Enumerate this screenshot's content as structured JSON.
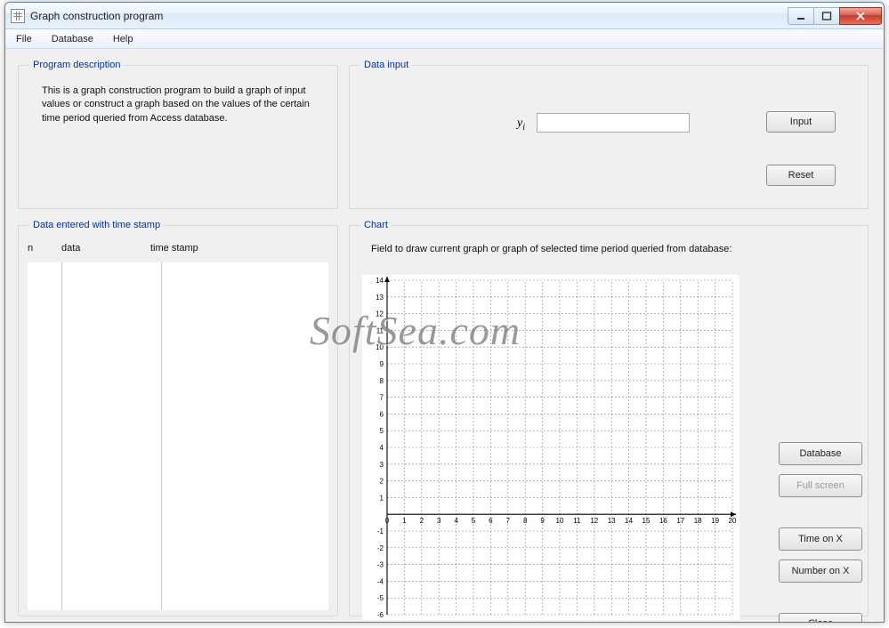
{
  "window": {
    "title": "Graph construction program"
  },
  "menu": {
    "file": "File",
    "database": "Database",
    "help": "Help"
  },
  "desc": {
    "legend": "Program description",
    "text": "This is a graph construction program to build a graph of input values or construct a graph based on the values of the certain time period queried from Access database."
  },
  "input": {
    "legend": "Data input",
    "y_label": "y",
    "y_sub": "i",
    "value": "",
    "input_btn": "Input",
    "reset_btn": "Reset"
  },
  "datatable": {
    "legend": "Data entered with time stamp",
    "col_n": "n",
    "col_data": "data",
    "col_ts": "time stamp"
  },
  "chart": {
    "legend": "Chart",
    "caption": "Field to draw current graph or graph of selected time period queried from database:"
  },
  "sidebar": {
    "database": "Database",
    "fullscreen": "Full screen",
    "time_x": "Time on X",
    "number_x": "Number on X",
    "close": "Close"
  },
  "watermark": "SoftSea.com",
  "chart_data": {
    "type": "line",
    "title": "",
    "xlabel": "",
    "ylabel": "",
    "x_ticks": [
      0,
      1,
      2,
      3,
      4,
      5,
      6,
      7,
      8,
      9,
      10,
      11,
      12,
      13,
      14,
      15,
      16,
      17,
      18,
      19,
      20
    ],
    "y_ticks": [
      -6,
      -5,
      -4,
      -3,
      -2,
      -1,
      0,
      1,
      2,
      3,
      4,
      5,
      6,
      7,
      8,
      9,
      10,
      11,
      12,
      13,
      14
    ],
    "xlim": [
      0,
      20
    ],
    "ylim": [
      -6,
      14
    ],
    "series": []
  }
}
